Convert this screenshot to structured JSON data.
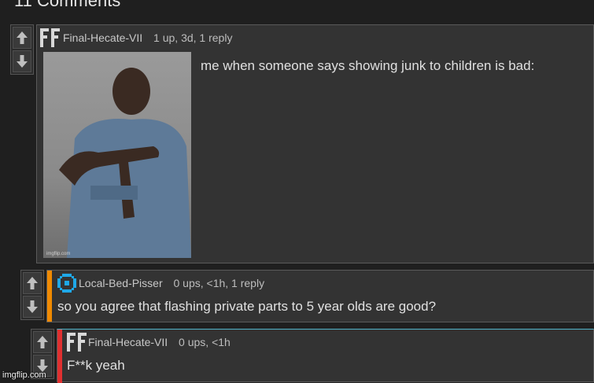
{
  "heading": "11 Comments",
  "comments": [
    {
      "user": "Final-Hecate-VII",
      "meta": "1 up, 3d, 1 reply",
      "text": "me when someone says showing junk to children is bad:",
      "accent": ""
    },
    {
      "user": "Local-Bed-Pisser",
      "meta": "0 ups, <1h, 1 reply",
      "text": "so you agree that flashing private parts to 5 year olds are good?",
      "accent": "#f08a00"
    },
    {
      "user": "Final-Hecate-VII",
      "meta": "0 ups, <1h",
      "text": "F**k yeah",
      "accent": "#e03030"
    }
  ],
  "icons": {
    "upvote": "arrow-up-icon",
    "downvote": "arrow-down-icon",
    "ff_avatar": "ff-avatar-icon",
    "ring_avatar": "pixel-ring-avatar-icon"
  },
  "watermark": "imgflip.com",
  "colors": {
    "background": "#1f1f1f",
    "card": "#333333",
    "reply1_accent": "#f08a00",
    "reply2_accent": "#e03030",
    "ring_avatar": "#1fa8e8"
  }
}
